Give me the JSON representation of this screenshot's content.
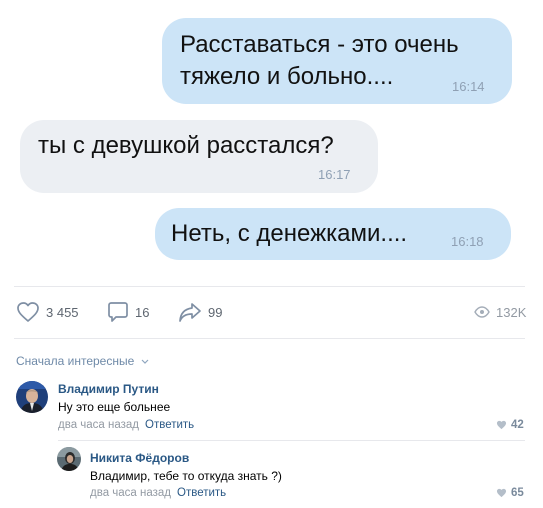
{
  "messages": [
    {
      "line1": "Расставаться - это очень",
      "line2": "тяжело и больно....",
      "time": "16:14"
    },
    {
      "text": "ты с девушкой расстался?",
      "time": "16:17"
    },
    {
      "text": "Неть, с денежками....",
      "time": "16:18"
    }
  ],
  "stats": {
    "likes": "3 455",
    "comments": "16",
    "shares": "99",
    "views": "132K"
  },
  "sort_label": "Сначала интересные",
  "comments": [
    {
      "author": "Владимир Путин",
      "text": "Ну это еще больнее",
      "time": "два часа назад",
      "reply": "Ответить",
      "likes": "42"
    },
    {
      "author": "Никита Фёдоров",
      "text": "Владимир, тебе то откуда знать ?)",
      "time": "два часа назад",
      "reply": "Ответить",
      "likes": "65"
    }
  ]
}
